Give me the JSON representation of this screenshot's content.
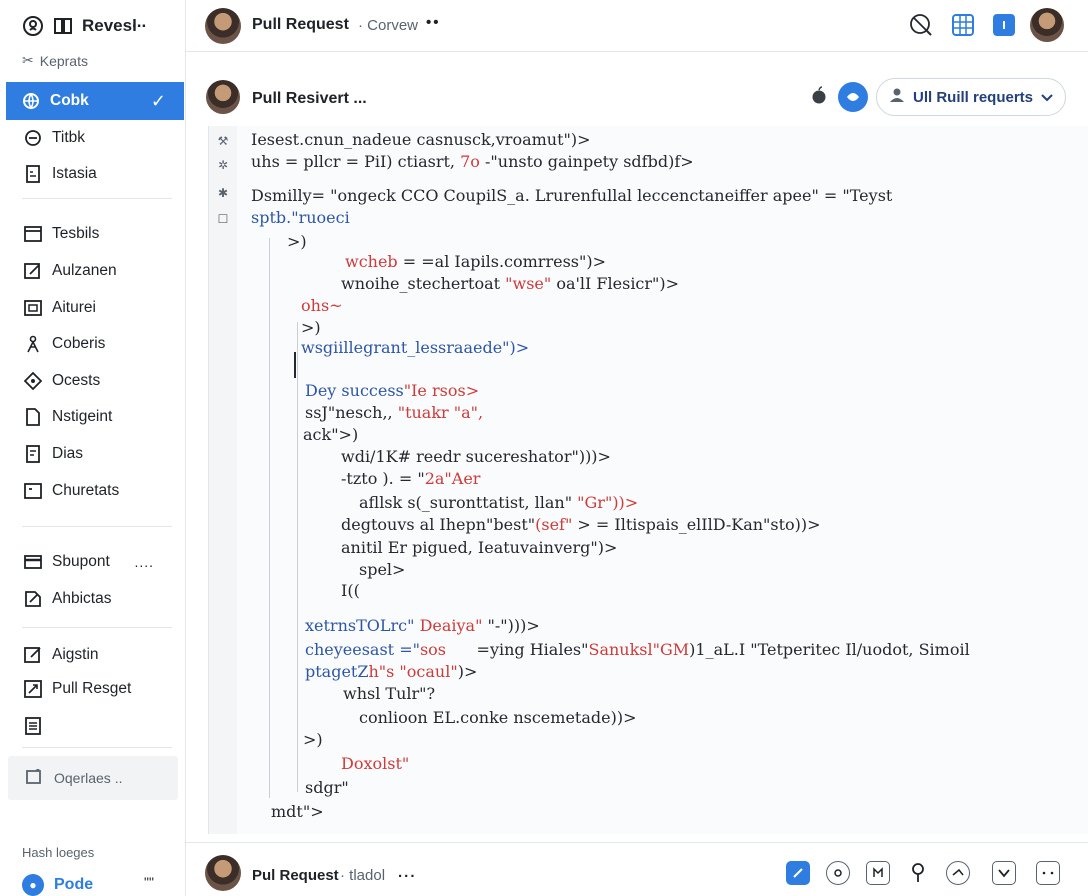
{
  "sidebar": {
    "brand": "Revesl",
    "brand_more": "...",
    "subtitle": "Keprats",
    "items": [
      {
        "label": "Cobk",
        "active": true
      },
      {
        "label": "Titbk"
      },
      {
        "label": "Istasia"
      },
      {
        "label": "Tesbils"
      },
      {
        "label": "Aulzanen"
      },
      {
        "label": "Aiturei"
      },
      {
        "label": "Coberis"
      },
      {
        "label": "Ocests"
      },
      {
        "label": "Nstigeint"
      },
      {
        "label": "Dias"
      },
      {
        "label": "Churetats"
      },
      {
        "label": "Sbupont",
        "more": "...."
      },
      {
        "label": "Ahbictas"
      },
      {
        "label": "Aigstin"
      },
      {
        "label": "Pull Resget"
      }
    ],
    "search_placeholder": "Oqerlaes ..",
    "section_label": "Hash loeges",
    "footer_label": "Pode",
    "footer_more": "\"\""
  },
  "topbar": {
    "title": "Pull Request",
    "crumb": "· Corvew",
    "dots": "••"
  },
  "pr": {
    "title": "Pull Resivert ...",
    "dropdown_label": "Ull Ruill requerts"
  },
  "code": {
    "lines": [
      {
        "t": "Iesest.cnun_nadeue casnusck,vroamut\")>",
        "c": ""
      },
      {
        "t": "uhs = pllcr = PiI) ctiasrt, ",
        "c": "",
        "tail": "7o",
        "tail_c": "red",
        "tail2": " -\"unsto gainpety sdfbd)f>",
        "tail2_c": ""
      },
      {
        "t": "Dsmilly= \"ongeck CCO CoupilS_a. Lrurenfullal leccenctaneiffer apee\" = \"Teyst",
        "c": ""
      },
      {
        "t": "sptb.\"ruoeci",
        "c": "blue"
      },
      {
        "t": ">)",
        "c": ""
      },
      {
        "t": "wcheb",
        "c": "red",
        "tail": " = =al Iapils.comrress\")>",
        "tail_c": ""
      },
      {
        "t": "wnoihe_stechertoat ",
        "c": "",
        "tail": "\"wse\"",
        "tail_c": "red",
        "tail2": " oa'lI Flesicr\")>",
        "tail2_c": ""
      },
      {
        "t": "ohs~",
        "c": "red"
      },
      {
        "t": ">)",
        "c": ""
      },
      {
        "t": "wsgiillegrant_lessraaede\")>",
        "c": "blue",
        "tail": "",
        "tail_c": ""
      },
      {
        "t": "Dey success",
        "c": "blue",
        "tail": "\"Ie rsos>",
        "tail_c": "red"
      },
      {
        "t": "ssJ\"nesch,, ",
        "c": "",
        "tail": "\"tuakr \"a\",",
        "tail_c": "red"
      },
      {
        "t": "ack\">)",
        "c": ""
      },
      {
        "t": "wdi/1K# reedr sucereshator\")))>",
        "c": ""
      },
      {
        "t": "-tzto ). = \"",
        "c": "",
        "tail": "2a\"Aer",
        "tail_c": "red"
      },
      {
        "t": "afllsk s(_suronttatist, llan\"",
        "c": "",
        "tail": " \"Gr\"))>",
        "tail_c": "red"
      },
      {
        "t": "degtouvs al Ihepn\"best\"",
        "c": "",
        "tail": "(sef\"",
        "tail_c": "red",
        "tail2": " > = Iltispais_elIlD-Kan\"sto))>",
        "tail2_c": ""
      },
      {
        "t": "anitil Er pigued, Ieatuvainverg\")>",
        "c": ""
      },
      {
        "t": "spel>",
        "c": ""
      },
      {
        "t": "I((",
        "c": ""
      },
      {
        "t": "xetrnsTOLrc\" ",
        "c": "blue",
        "tail": "Deaiya\"",
        "tail_c": "red",
        "tail2": " \"-\")))>",
        "tail2_c": ""
      },
      {
        "t": "cheyeesast =\"",
        "c": "blue",
        "tail": "sos",
        "tail_c": "red",
        "tail2": "      =ying Hiales\"",
        "tail2_c": "",
        "tail3": "Sanuksl\"GM",
        "tail3_c": "red",
        "tail4": ")1_aL.I \"Tetperitec Il/uodot, Simoil",
        "tail4_c": ""
      },
      {
        "t": "ptagetZ",
        "c": "blue",
        "tail": "h\"s \"ocaul\"",
        "tail_c": "red",
        "tail2": ")>",
        "tail2_c": ""
      },
      {
        "t": "whsl Tulr\"?",
        "c": ""
      },
      {
        "t": "conlioon EL.conke nscemetade))>",
        "c": ""
      },
      {
        "t": ">)",
        "c": ""
      },
      {
        "t": "Doxolst\"",
        "c": "red"
      },
      {
        "t": "sdgr\"",
        "c": ""
      },
      {
        "t": "mdt\">",
        "c": ""
      }
    ]
  },
  "bottombar": {
    "title": "Pul Request",
    "crumb": "· tladol",
    "dots": "..."
  },
  "colors": {
    "accent": "#2f7de1",
    "code_blue": "#2d56a8",
    "code_red": "#cf3a3a"
  }
}
